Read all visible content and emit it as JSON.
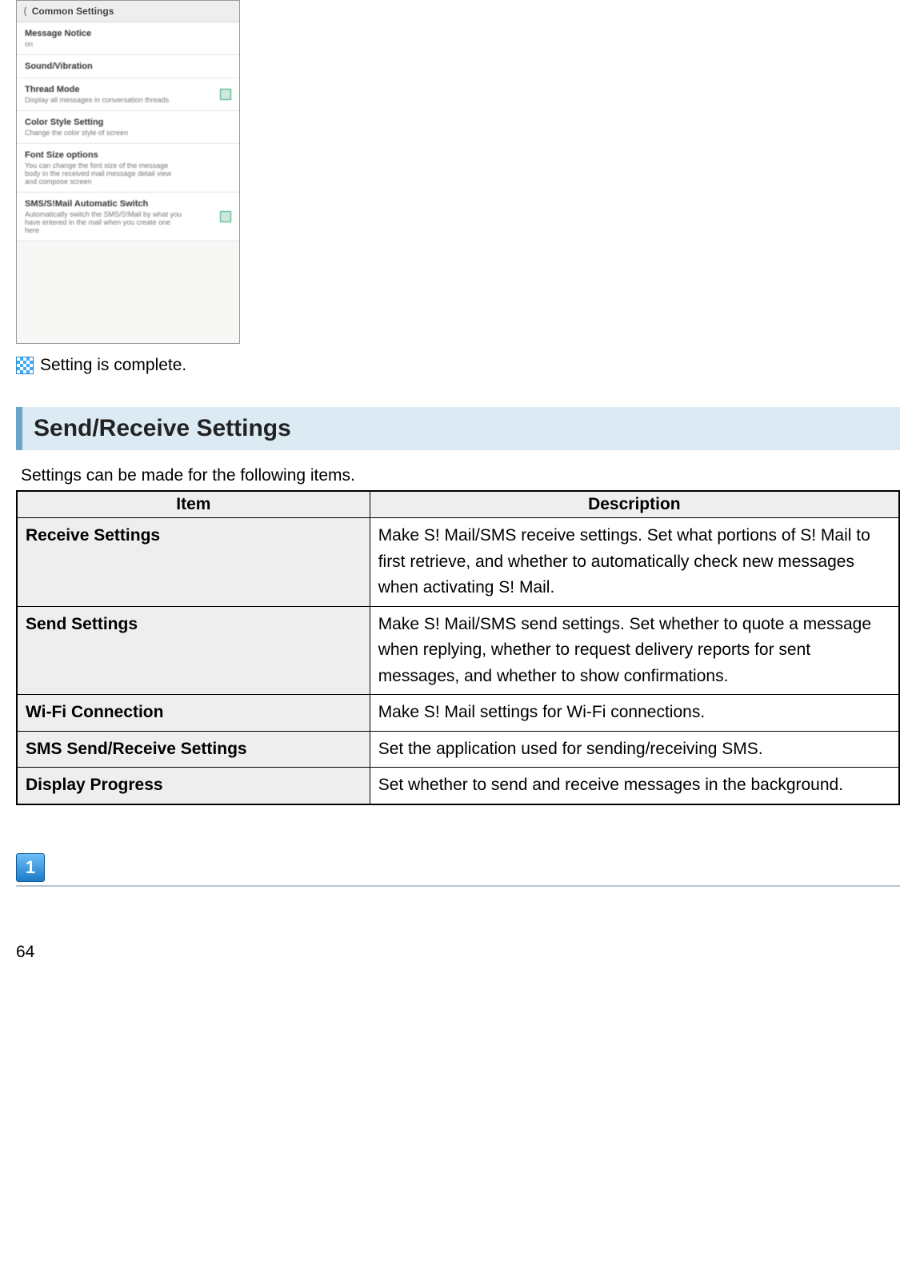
{
  "screenshot": {
    "title": "Common Settings",
    "rows": [
      {
        "label": "Message Notice",
        "sub": "on",
        "toggle": false
      },
      {
        "label": "Sound/Vibration",
        "sub": "",
        "toggle": false
      },
      {
        "label": "Thread Mode",
        "sub": "Display all messages in conversation threads",
        "toggle": true
      },
      {
        "label": "Color Style Setting",
        "sub": "Change the color style of screen",
        "toggle": false
      },
      {
        "label": "Font Size options",
        "sub": "You can change the font size of the message body in the received mail message detail view and compose screen",
        "toggle": false
      },
      {
        "label": "SMS/S!Mail Automatic Switch",
        "sub": "Automatically switch the SMS/S!Mail by what you have entered in the mail when you create one here",
        "toggle": true
      }
    ]
  },
  "complete_text": "Setting is complete.",
  "heading": "Send/Receive Settings",
  "intro": "Settings can be made for the following items.",
  "table": {
    "headers": {
      "item": "Item",
      "desc": "Description"
    },
    "rows": [
      {
        "item": "Receive Settings",
        "desc": "Make S! Mail/SMS receive settings. Set what portions of S! Mail to first retrieve, and whether to automatically check new messages when activating S! Mail."
      },
      {
        "item": "Send Settings",
        "desc": "Make S! Mail/SMS send settings. Set whether to quote a message when replying, whether to request delivery reports for sent messages, and whether to show confirmations."
      },
      {
        "item": "Wi-Fi Connection",
        "desc": "Make S! Mail settings for Wi-Fi connections."
      },
      {
        "item": "SMS Send/Receive Settings",
        "desc": "Set the application used for sending/receiving SMS."
      },
      {
        "item": "Display Progress",
        "desc": "Set whether to send and receive messages in the background."
      }
    ]
  },
  "step_number": "1",
  "page_number": "64"
}
